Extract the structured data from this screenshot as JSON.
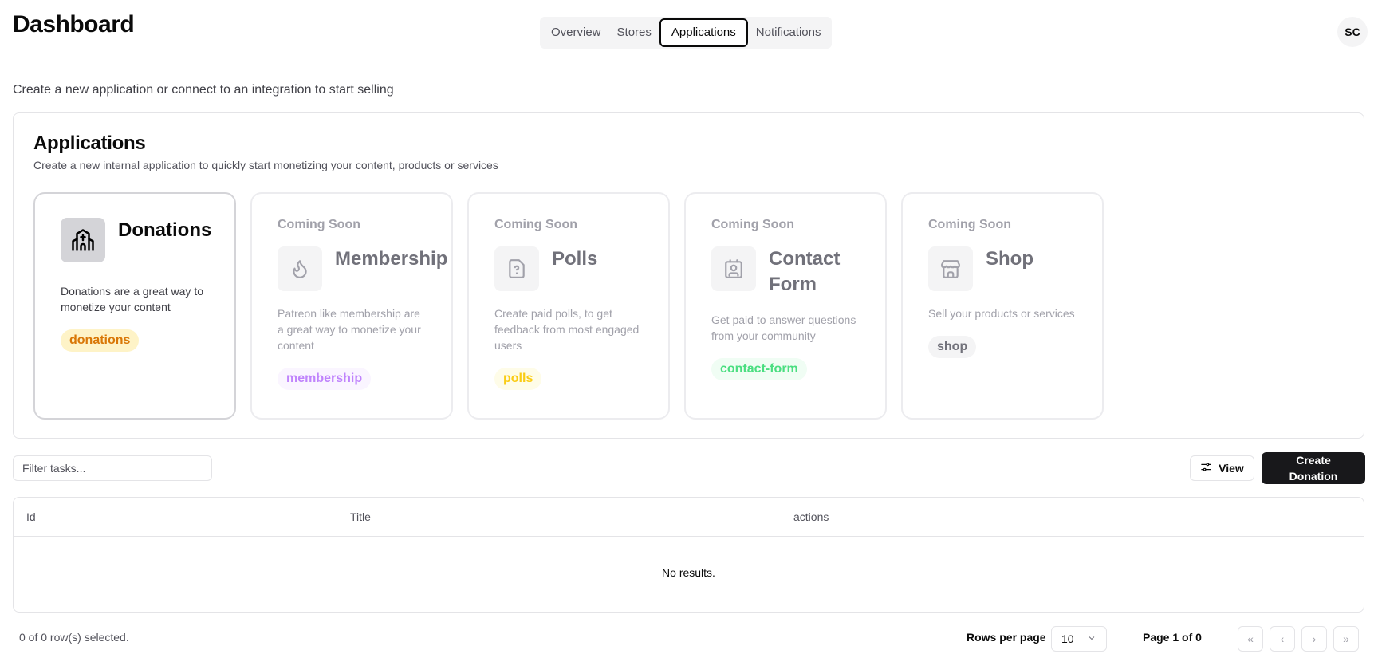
{
  "header": {
    "title": "Dashboard",
    "avatar": "SC",
    "tabs": [
      {
        "label": "Overview"
      },
      {
        "label": "Stores"
      },
      {
        "label": "Applications",
        "active": true
      },
      {
        "label": "Notifications"
      }
    ]
  },
  "subtitle": "Create a new application or connect to an integration to start selling",
  "applications": {
    "title": "Applications",
    "description": "Create a new internal application to quickly start monetizing your content, products or services",
    "cards": [
      {
        "title": "Donations",
        "description": "Donations are a great way to monetize your content",
        "badge": "donations",
        "icon": "church-icon",
        "badge_color": "#d97706",
        "badge_bg": "#fef3c7"
      },
      {
        "status": "Coming Soon",
        "title": "Membership",
        "description": "Patreon like membership are a great way to monetize your content",
        "badge": "membership",
        "icon": "flame-icon",
        "badge_color": "#c084fc",
        "badge_bg": "#faf5ff"
      },
      {
        "status": "Coming Soon",
        "title": "Polls",
        "description": "Create paid polls, to get feedback from most engaged users",
        "badge": "polls",
        "icon": "file-question-icon",
        "badge_color": "#facc15",
        "badge_bg": "#fefce8"
      },
      {
        "status": "Coming Soon",
        "title": "Contact Form",
        "description": "Get paid to answer questions from your community",
        "badge": "contact-form",
        "icon": "contact-icon",
        "badge_color": "#4ade80",
        "badge_bg": "#f0fdf4"
      },
      {
        "status": "Coming Soon",
        "title": "Shop",
        "description": "Sell your products or services",
        "badge": "shop",
        "icon": "store-icon",
        "badge_color": "#71717a",
        "badge_bg": "#f4f4f5"
      }
    ]
  },
  "toolbar": {
    "filter_placeholder": "Filter tasks...",
    "view_label": "View",
    "create_label": "Create Donation"
  },
  "table": {
    "columns": [
      "Id",
      "Title",
      "actions"
    ],
    "empty": "No results."
  },
  "footer": {
    "selected": "0 of 0 row(s) selected.",
    "rows_per_page_label": "Rows per page",
    "rows_per_page": "10",
    "page": "Page 1 of 0"
  }
}
